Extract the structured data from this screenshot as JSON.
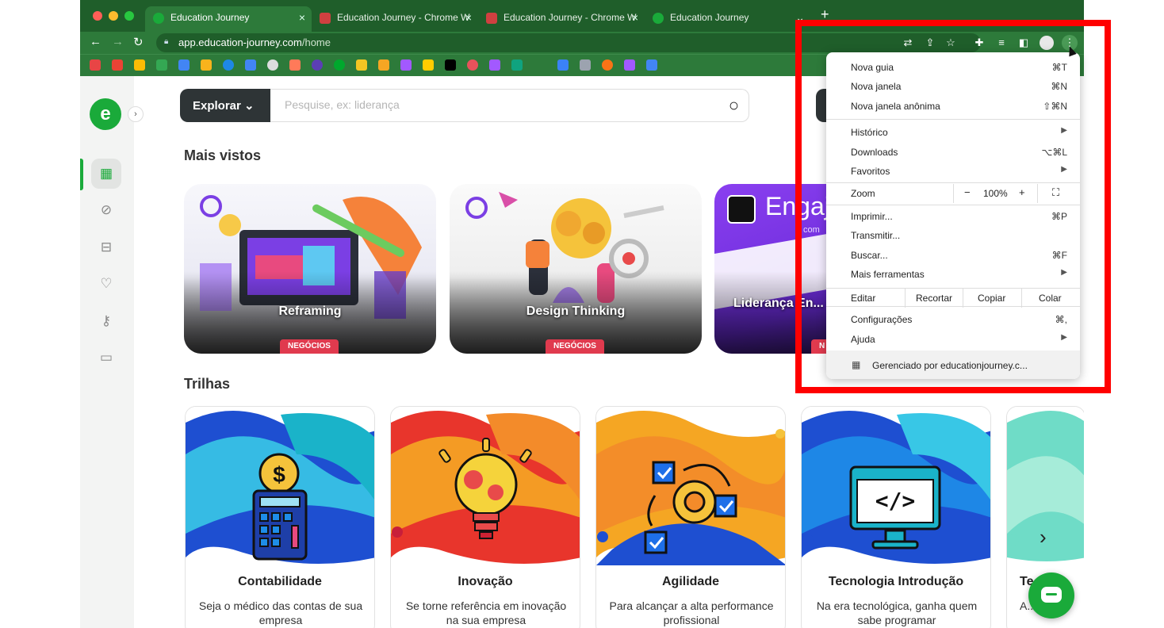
{
  "browser": {
    "tabs": [
      {
        "label": "Education Journey",
        "favicon_color": "#1aaa3a",
        "active": true
      },
      {
        "label": "Education Journey - Chrome W",
        "favicon_color": "#d04040",
        "active": false
      },
      {
        "label": "Education Journey - Chrome W",
        "favicon_color": "#d04040",
        "active": false
      },
      {
        "label": "Education Journey",
        "favicon_color": "#1aaa3a",
        "active": false
      }
    ],
    "new_tab_label": "+",
    "url_host": "app.education-journey.com",
    "url_path": "/home"
  },
  "sidebar": {
    "logo_letter": "e",
    "items": [
      {
        "icon": "grid-icon",
        "glyph": "▦",
        "active": true
      },
      {
        "icon": "compass-icon",
        "glyph": "⊘",
        "active": false
      },
      {
        "icon": "briefcase-icon",
        "glyph": "⊟",
        "active": false
      },
      {
        "icon": "heart-icon",
        "glyph": "♡",
        "active": false
      },
      {
        "icon": "key-icon",
        "glyph": "⚷",
        "active": false
      },
      {
        "icon": "chat-icon",
        "glyph": "▭",
        "active": false
      }
    ]
  },
  "search": {
    "explore_label": "Explorar",
    "placeholder": "Pesquise, ex: liderança"
  },
  "most_viewed": {
    "heading": "Mais vistos",
    "cards": [
      {
        "title": "Reframing",
        "badge": "NEGÓCIOS"
      },
      {
        "title": "Design Thinking",
        "badge": "NEGÓCIOS"
      },
      {
        "title": "Liderança En... Olhar D...",
        "badge": "N",
        "brand": "Engaj",
        "brand_sub": "com"
      }
    ]
  },
  "trails": {
    "heading": "Trilhas",
    "items": [
      {
        "title": "Contabilidade",
        "desc": "Seja o médico das contas de sua empresa"
      },
      {
        "title": "Inovação",
        "desc": "Se torne referência em inovação na sua empresa"
      },
      {
        "title": "Agilidade",
        "desc": "Para alcançar a alta performance profissional"
      },
      {
        "title": "Tecnologia Introdução",
        "desc": "Na era tecnológica, ganha quem sabe programar"
      },
      {
        "title": "Te",
        "desc": "A... d..."
      }
    ]
  },
  "chrome_menu": {
    "new_tab": {
      "label": "Nova guia",
      "shortcut": "⌘T"
    },
    "new_window": {
      "label": "Nova janela",
      "shortcut": "⌘N"
    },
    "incognito": {
      "label": "Nova janela anônima",
      "shortcut": "⇧⌘N"
    },
    "history": {
      "label": "Histórico"
    },
    "downloads": {
      "label": "Downloads",
      "shortcut": "⌥⌘L"
    },
    "bookmarks": {
      "label": "Favoritos"
    },
    "zoom": {
      "label": "Zoom",
      "minus": "−",
      "value": "100%",
      "plus": "+",
      "fullscreen": "⛶"
    },
    "print": {
      "label": "Imprimir...",
      "shortcut": "⌘P"
    },
    "cast": {
      "label": "Transmitir..."
    },
    "find": {
      "label": "Buscar...",
      "shortcut": "⌘F"
    },
    "more_tools": {
      "label": "Mais ferramentas"
    },
    "edit": {
      "label": "Editar",
      "cut": "Recortar",
      "copy": "Copiar",
      "paste": "Colar"
    },
    "settings": {
      "label": "Configurações",
      "shortcut": "⌘,"
    },
    "help": {
      "label": "Ajuda"
    },
    "managed": {
      "label": "Gerenciado por educationjourney.c..."
    }
  },
  "colors": {
    "brand_green": "#1aaa3a",
    "chrome_dark_green": "#1f5e2a",
    "highlight_red": "#ff0000",
    "badge_red": "#e03a4e"
  }
}
